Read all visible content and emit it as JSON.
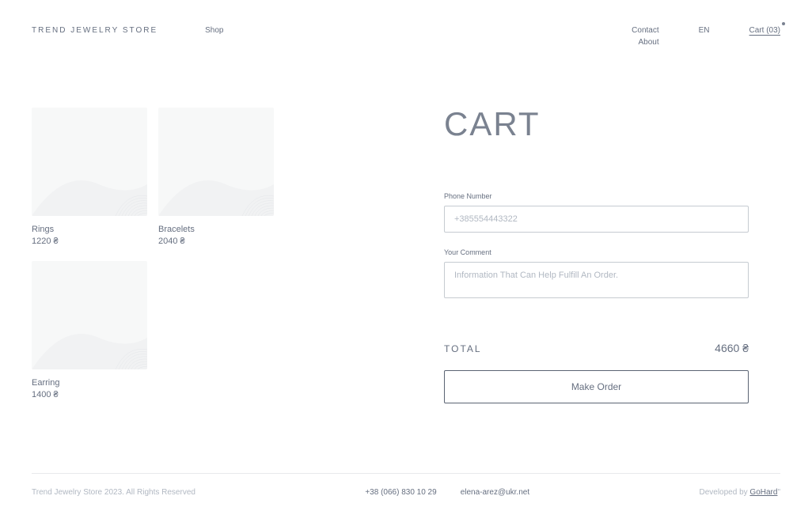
{
  "header": {
    "brand": "TREND JEWELRY STORE",
    "shop": "Shop",
    "contact": "Contact",
    "about": "About",
    "lang": "EN",
    "cart": "Cart (03)"
  },
  "products": [
    {
      "name": "Rings",
      "price": "1220 ₴"
    },
    {
      "name": "Bracelets",
      "price": "2040 ₴"
    },
    {
      "name": "Earring",
      "price": "1400 ₴"
    }
  ],
  "cart": {
    "title": "CART",
    "phone_label": "Phone Number",
    "phone_placeholder": "+385554443322",
    "comment_label": "Your Comment",
    "comment_placeholder": "Information That Can Help Fulfill An Order.",
    "total_label": "TOTAL",
    "total_value": "4660 ₴",
    "make_order": "Make Order"
  },
  "footer": {
    "copyright": "Trend Jewelry Store 2023. All Rights Reserved",
    "phone": "+38 (066) 830 10 29",
    "email": "elena-arez@ukr.net",
    "developed_by": "Developed by ",
    "developer": "GoHard"
  }
}
